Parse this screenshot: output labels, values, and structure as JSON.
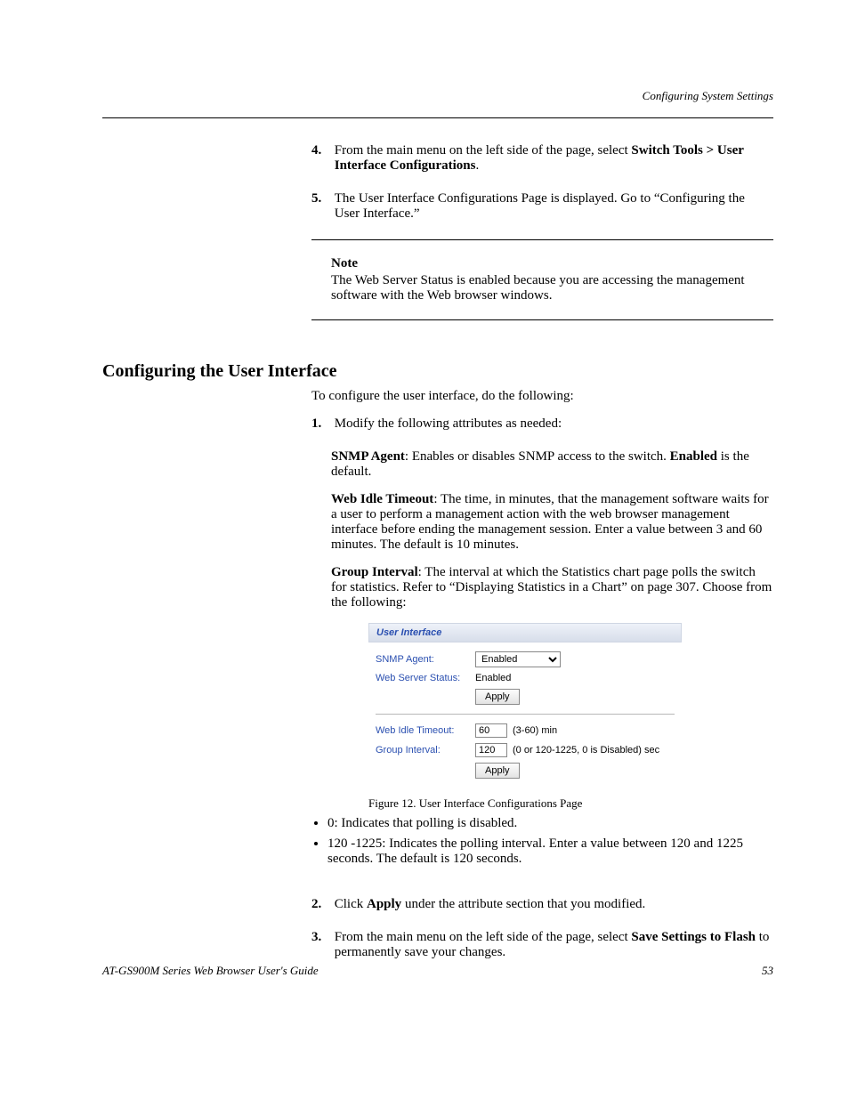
{
  "header": {
    "running_head": "Configuring System Settings"
  },
  "steps": {
    "step4_num": "4.",
    "step4_text": "From the main menu on the left side of the page, select ",
    "step4_bold": "Switch Tools > User Interface Configurations",
    "step4_tail": ".",
    "step5_num": "5.",
    "step5_text": "The User Interface Configurations Page is displayed. Go to “Configuring the User Interface.”"
  },
  "note": {
    "label": "Note",
    "text": "The Web Server Status is enabled because you are accessing the management software with the Web browser windows."
  },
  "section_title": "Configuring the User Interface",
  "attrs": {
    "lead": "To configure the user interface, do the following:",
    "s1_num": "1.",
    "s1_text": "Modify the following attributes as needed:",
    "snmp_label": "SNMP Agent",
    "snmp_body": ": Enables or disables SNMP access to the switch. ",
    "snmp_bold": "Enabled",
    "snmp_tail": " is the default.",
    "wit_label": "Web Idle Timeout",
    "wit_body": ": The time, in minutes, that the management software waits for a user to perform a management action with the web browser management interface before ending the management session. Enter a value between 3 and 60 minutes. The default is 10 minutes.",
    "gi_label": "Group Interval",
    "gi_body": ": The interval at which the Statistics chart page polls the switch for statistics. Refer to “Displaying Statistics in a Chart” on page 307. Choose from the following:",
    "gi_bullet1": "0: Indicates that polling is disabled.",
    "gi_bullet2": "120 -1225: Indicates the polling interval. Enter a value between 120 and 1225 seconds. The default is 120 seconds.",
    "s2_num": "2.",
    "s2_text": "Click ",
    "s2_bold": "Apply",
    "s2_tail": " under the attribute section that you modified.",
    "s3_num": "3.",
    "s3_text": "From the main menu on the left side of the page, select ",
    "s3_bold": "Save Settings to Flash",
    "s3_tail": " to permanently save your changes."
  },
  "ui": {
    "title": "User Interface",
    "snmp_label": "SNMP Agent:",
    "snmp_value": "Enabled",
    "wss_label": "Web Server Status:",
    "wss_value": "Enabled",
    "apply_label": "Apply",
    "wit_label": "Web Idle Timeout:",
    "wit_value": "60",
    "wit_hint": "(3-60) min",
    "gi_label": "Group Interval:",
    "gi_value": "120",
    "gi_hint": "(0 or 120-1225, 0 is Disabled) sec"
  },
  "figure_caption": "Figure 12. User Interface Configurations Page",
  "footer": {
    "left": "AT-GS900M Series Web Browser User's Guide",
    "right": "53"
  }
}
